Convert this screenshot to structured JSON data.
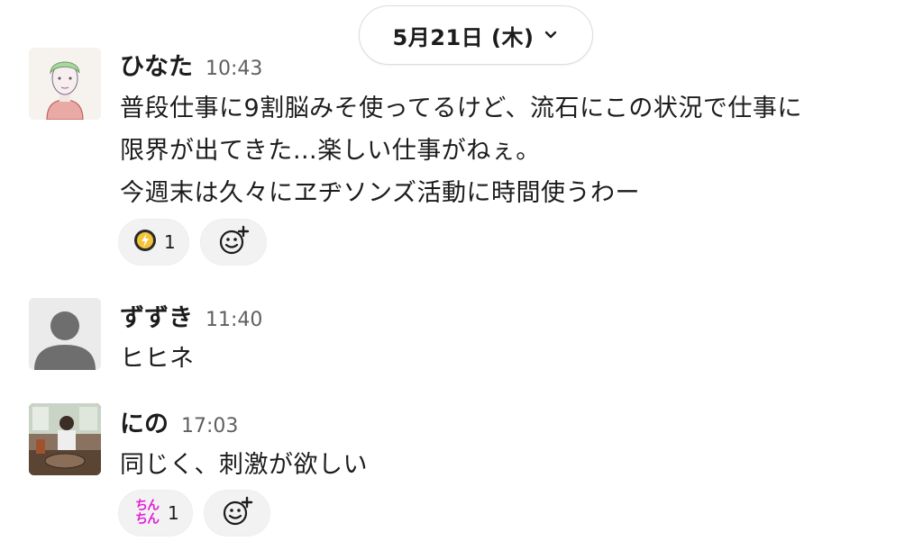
{
  "date_divider": {
    "label": "5月21日 (木)",
    "chevron_icon": "chevron-down-icon"
  },
  "messages": [
    {
      "author": "ひなた",
      "time": "10:43",
      "lines": [
        "普段仕事に9割脳みそ使ってるけど、流石にこの状況で仕事に",
        "限界が出てきた…楽しい仕事がねぇ。",
        "今週末は久々にヱヂソンズ活動に時間使うわー"
      ],
      "reactions": [
        {
          "emoji": "lightning-badge-icon",
          "count": "1"
        }
      ],
      "add_reaction_icon": "add-emoji-icon"
    },
    {
      "author": "ずずき",
      "time": "11:40",
      "lines": [
        "ヒヒネ"
      ],
      "reactions": []
    },
    {
      "author": "にの",
      "time": "17:03",
      "lines": [
        "同じく、刺激が欲しい"
      ],
      "reactions": [
        {
          "emoji": "chin-chin-emoji",
          "emoji_text": [
            "ちん",
            "ちん"
          ],
          "count": "1"
        }
      ],
      "add_reaction_icon": "add-emoji-icon"
    }
  ],
  "colors": {
    "reaction_bg": "#f2f2f2",
    "chin_text": "#e020d8",
    "timestamp": "#616061"
  }
}
